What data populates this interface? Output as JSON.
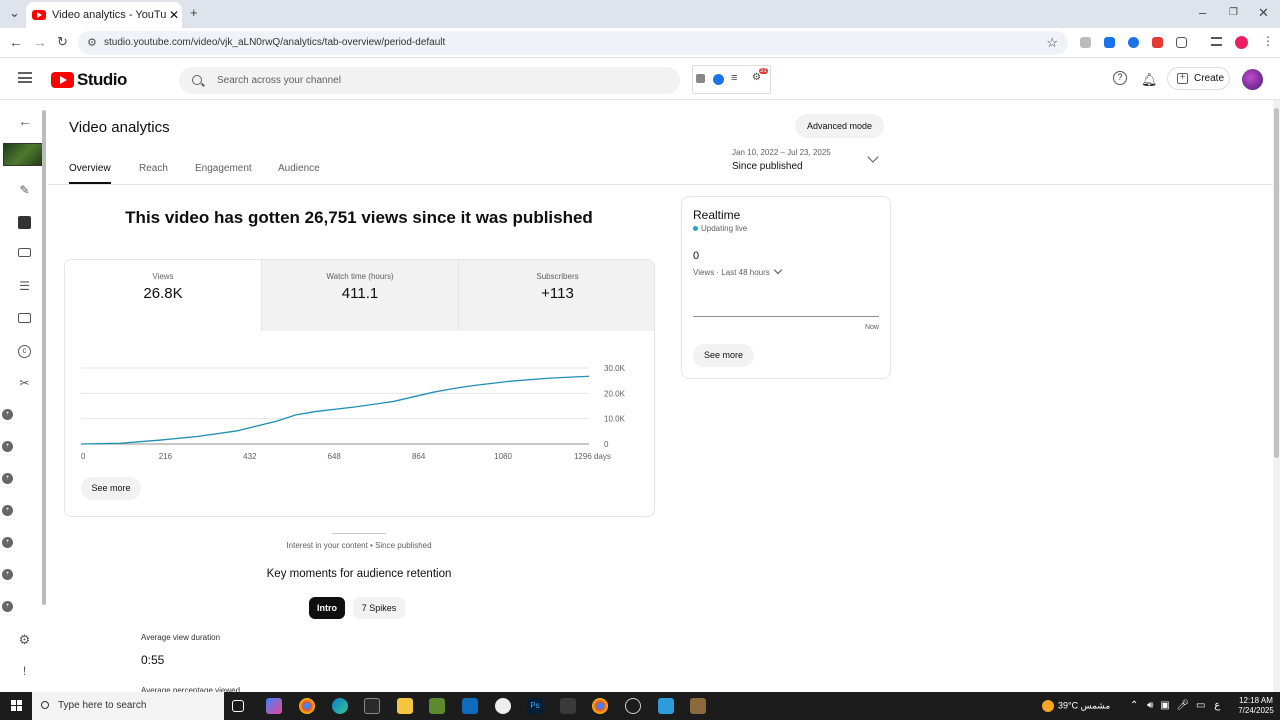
{
  "browser": {
    "tab_title": "Video analytics - YouTube Studi",
    "url": "studio.youtube.com/video/vjk_aLN0rwQ/analytics/tab-overview/period-default"
  },
  "header": {
    "logo_text": "Studio",
    "search_placeholder": "Search across your channel",
    "create_label": "Create",
    "ext_badge": "31"
  },
  "page": {
    "title": "Video analytics",
    "advanced_mode": "Advanced mode",
    "tabs": [
      {
        "label": "Overview"
      },
      {
        "label": "Reach"
      },
      {
        "label": "Engagement"
      },
      {
        "label": "Audience"
      }
    ],
    "date_range": "Jan 10, 2022 – Jul 23, 2025",
    "period": "Since published",
    "headline": "This video has gotten 26,751 views since it was published",
    "metrics": [
      {
        "label": "Views",
        "value": "26.8K"
      },
      {
        "label": "Watch time (hours)",
        "value": "411.1"
      },
      {
        "label": "Subscribers",
        "value": "+113"
      }
    ],
    "see_more": "See more",
    "interest_caption": "Interest in your content • Since published",
    "key_moments_title": "Key moments for audience retention",
    "chip_intro": "Intro",
    "chip_spikes": "7 Spikes",
    "avg_view_duration_label": "Average view duration",
    "avg_view_duration_value": "0:55",
    "avg_pct_viewed_label": "Average percentage viewed"
  },
  "realtime": {
    "title": "Realtime",
    "status": "Updating live",
    "value": "0",
    "meta": "Views · Last 48 hours",
    "now_label": "Now",
    "see_more": "See more"
  },
  "chart_data": {
    "type": "line",
    "xlabel": "",
    "ylabel": "",
    "x_ticks": [
      "0",
      "216",
      "432",
      "648",
      "864",
      "1080",
      "1296 days"
    ],
    "y_ticks": [
      "30.0K",
      "20.0K",
      "10.0K",
      "0"
    ],
    "xlim": [
      0,
      1300
    ],
    "ylim": [
      0,
      30000
    ],
    "series": [
      {
        "color": "#1e8fb5",
        "x": [
          0,
          100,
          200,
          300,
          400,
          500,
          550,
          600,
          700,
          800,
          900,
          950,
          1000,
          1100,
          1200,
          1300
        ],
        "y": [
          0,
          300,
          1500,
          3000,
          5200,
          9000,
          11500,
          12800,
          14600,
          16800,
          20400,
          21800,
          23000,
          24800,
          26000,
          26751
        ]
      }
    ]
  },
  "taskbar": {
    "search_placeholder": "Type here to search",
    "weather": "39°C  مشمس",
    "lang": "ع",
    "time": "12:18 AM",
    "date": "7/24/2025"
  },
  "colors": {
    "accent": "#ff0000",
    "line": "#1e8fb5",
    "live_dot": "#1ea7c2"
  }
}
